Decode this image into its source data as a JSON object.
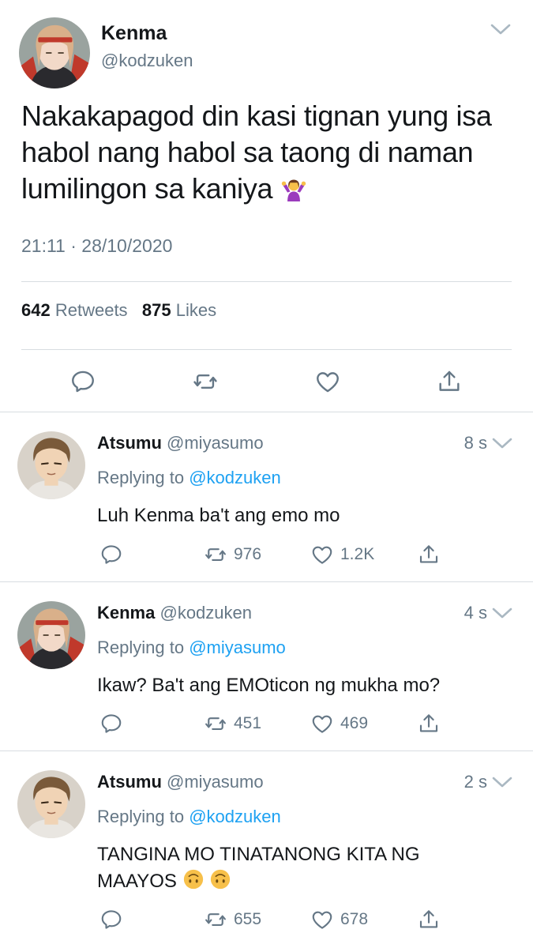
{
  "main_tweet": {
    "author": {
      "name": "Kenma",
      "handle": "@kodzuken"
    },
    "text": "Nakakapagod din kasi tignan yung isa habol nang habol sa taong di naman lumilingon sa kaniya",
    "emoji": "person-shrugging-emoji",
    "timestamp": "21:11 · 28/10/2020",
    "retweets": {
      "count": "642",
      "label": "Retweets"
    },
    "likes": {
      "count": "875",
      "label": "Likes"
    },
    "actions": [
      "reply-icon",
      "retweet-icon",
      "like-icon",
      "share-icon"
    ]
  },
  "replies": [
    {
      "name": "Atsumu",
      "handle": "@miyasumo",
      "age": "8 s",
      "replying_label": "Replying to",
      "replying_to": "@kodzuken",
      "text": "Luh Kenma ba't ang emo mo",
      "retweets": "976",
      "likes": "1.2K"
    },
    {
      "name": "Kenma",
      "handle": "@kodzuken",
      "age": "4 s",
      "replying_label": "Replying to",
      "replying_to": "@miyasumo",
      "text": "Ikaw? Ba't ang EMOticon ng mukha mo?",
      "retweets": "451",
      "likes": "469"
    },
    {
      "name": "Atsumu",
      "handle": "@miyasumo",
      "age": "2 s",
      "replying_label": "Replying to",
      "replying_to": "@kodzuken",
      "text": "TANGINA MO TINATANONG KITA NG MAAYOS",
      "emoji": "upside-down-face-emoji",
      "retweets": "655",
      "likes": "678"
    }
  ],
  "colors": {
    "link": "#1da1f2",
    "secondary_text": "#657786",
    "divider": "#d8dde1",
    "icon": "#657786"
  }
}
